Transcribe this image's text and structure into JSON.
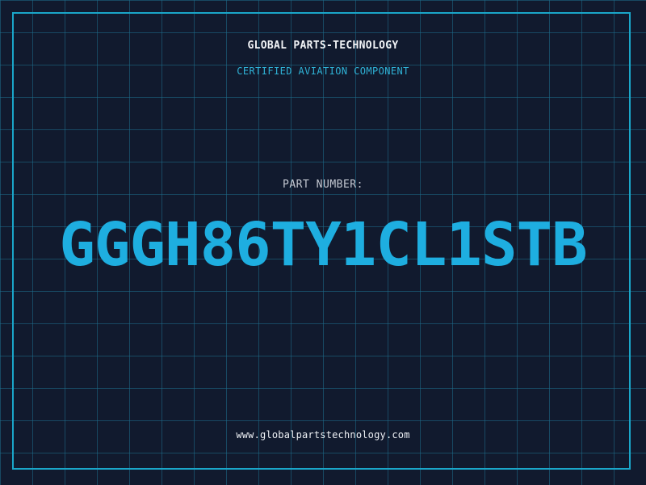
{
  "header": {
    "company": "GLOBAL PARTS-TECHNOLOGY",
    "tagline": "CERTIFIED AVIATION COMPONENT"
  },
  "part": {
    "label": "PART NUMBER:",
    "number": "GGGH86TY1CL1STB"
  },
  "footer": {
    "website": "www.globalpartstechnology.com"
  },
  "colors": {
    "background": "#111a2e",
    "grid": "#1e6e8c",
    "frame": "#1aa6c9",
    "accent": "#1eaee0",
    "tagline": "#2fb2d6"
  }
}
